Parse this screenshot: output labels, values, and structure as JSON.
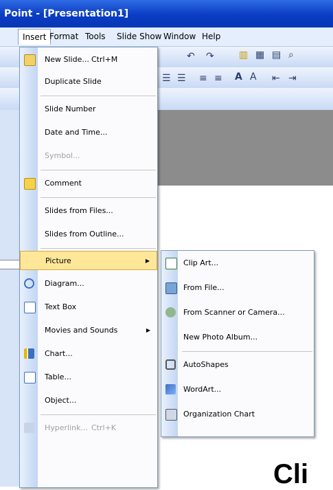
{
  "window": {
    "title": "Point - [Presentation1]"
  },
  "menubar": {
    "items": [
      "Insert",
      "Format",
      "Tools",
      "Slide Show",
      "Window",
      "Help"
    ]
  },
  "insert_menu": {
    "items": [
      {
        "label": "New Slide...",
        "shortcut": "Ctrl+M"
      },
      {
        "label": "Duplicate Slide"
      },
      {
        "label": "Slide Number"
      },
      {
        "label": "Date and Time..."
      },
      {
        "label": "Symbol..."
      },
      {
        "label": "Comment"
      },
      {
        "label": "Slides from Files..."
      },
      {
        "label": "Slides from Outline..."
      },
      {
        "label": "Picture"
      },
      {
        "label": "Diagram..."
      },
      {
        "label": "Text Box"
      },
      {
        "label": "Movies and Sounds"
      },
      {
        "label": "Chart..."
      },
      {
        "label": "Table..."
      },
      {
        "label": "Object..."
      },
      {
        "label": "Hyperlink...",
        "shortcut": "Ctrl+K"
      }
    ]
  },
  "picture_submenu": {
    "items": [
      {
        "label": "Clip Art..."
      },
      {
        "label": "From File..."
      },
      {
        "label": "From Scanner or Camera..."
      },
      {
        "label": "New Photo Album..."
      },
      {
        "label": "AutoShapes"
      },
      {
        "label": "WordArt..."
      },
      {
        "label": "Organization Chart"
      }
    ]
  },
  "slide": {
    "text": "Cli"
  },
  "colors": {
    "titlebar": "#0a3cc4",
    "menu_highlight": "#ffe79a",
    "gutter": "#c2d5f2"
  }
}
